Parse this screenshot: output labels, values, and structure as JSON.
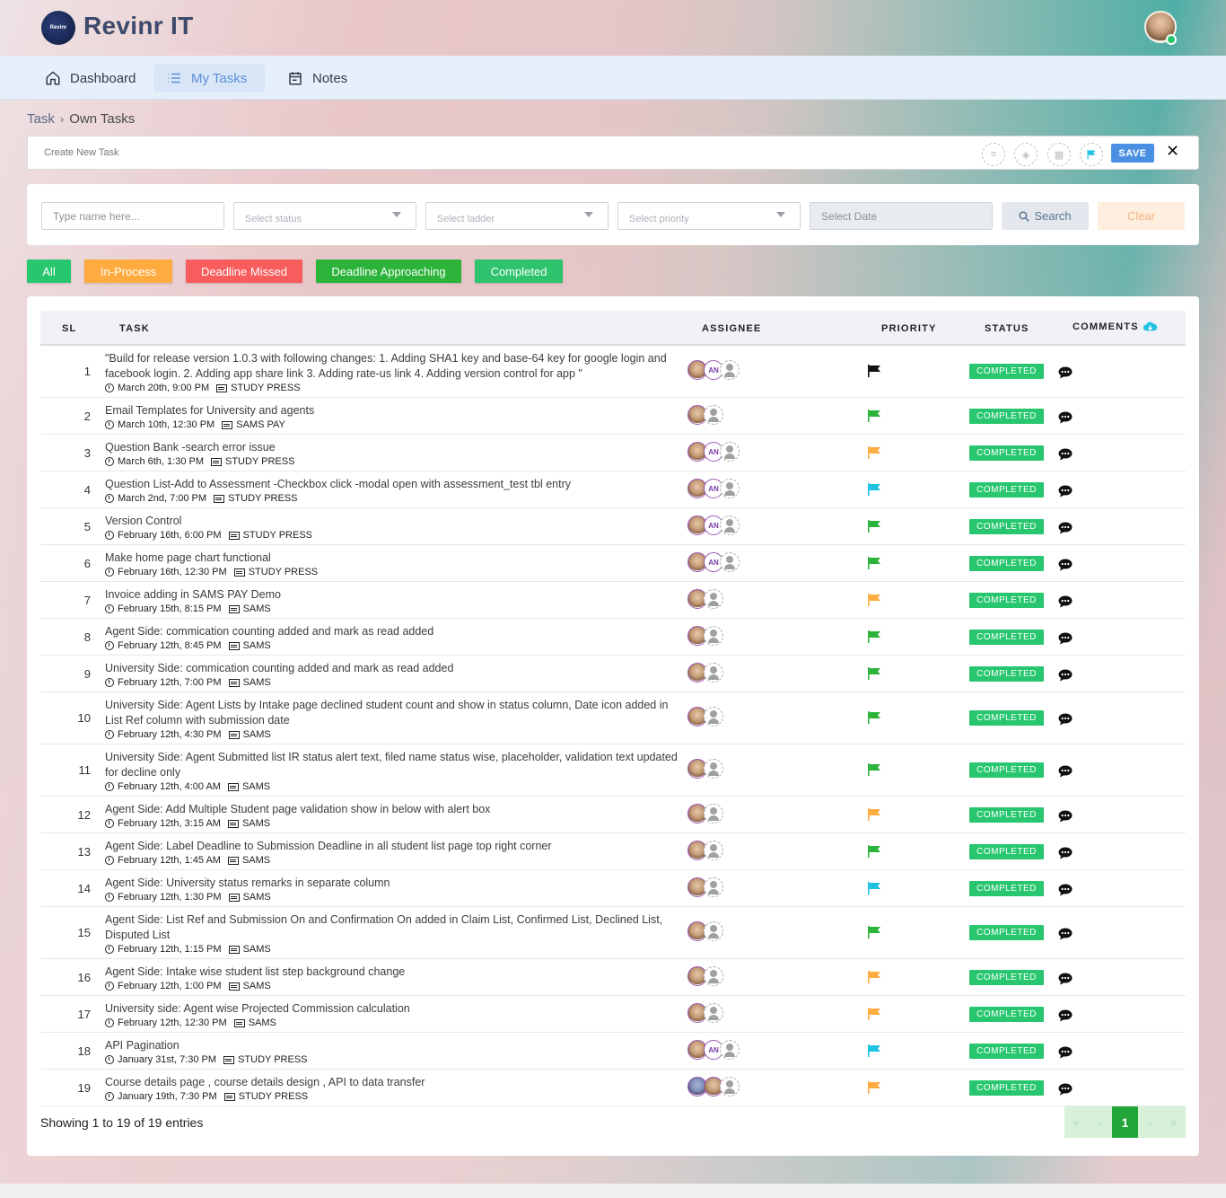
{
  "brand": {
    "name": "Revinr IT",
    "logo_text": "Revinr"
  },
  "nav": [
    {
      "label": "Dashboard",
      "icon": "home-icon"
    },
    {
      "label": "My Tasks",
      "icon": "list-icon",
      "active": true
    },
    {
      "label": "Notes",
      "icon": "calendar-icon"
    }
  ],
  "breadcrumb": {
    "parent": "Task",
    "current": "Own Tasks"
  },
  "create_task": {
    "placeholder": "Create New Task",
    "save_label": "SAVE"
  },
  "filters": {
    "name_placeholder": "Type name here...",
    "status_placeholder": "Select status",
    "ladder_placeholder": "Select ladder",
    "priority_placeholder": "Select priority",
    "date_placeholder": "Select Date",
    "search_label": "Search",
    "clear_label": "Clear"
  },
  "status_buttons": [
    {
      "label": "All",
      "color": "#28c76f"
    },
    {
      "label": "In-Process",
      "color": "#ffab40"
    },
    {
      "label": "Deadline Missed",
      "color": "#f85c5c"
    },
    {
      "label": "Deadline Approaching",
      "color": "#2bb33a"
    },
    {
      "label": "Completed",
      "color": "#2ec46d"
    }
  ],
  "table": {
    "headers": {
      "sl": "SL",
      "task": "TASK",
      "assignee": "ASSIGNEE",
      "priority": "PRIORITY",
      "status": "STATUS",
      "comments": "COMMENTS"
    },
    "rows": [
      {
        "sl": "1",
        "title": "\"Build for release version 1.0.3 with following changes: 1. Adding SHA1 key and base-64 key for google login and facebook login. 2. Adding app share link 3. Adding rate-us link 4. Adding version control for app \"",
        "date": "March 20th, 9:00 PM",
        "project": "STUDY PRESS",
        "an": true,
        "flag": "#111111",
        "status": "COMPLETED"
      },
      {
        "sl": "2",
        "title": "Email Templates for University and agents",
        "date": "March 10th, 12:30 PM",
        "project": "SAMS PAY",
        "an": false,
        "flag": "#2bb33a",
        "status": "COMPLETED"
      },
      {
        "sl": "3",
        "title": "Question Bank -search error issue",
        "date": "March 6th, 1:30 PM",
        "project": "STUDY PRESS",
        "an": true,
        "flag": "#ffab40",
        "status": "COMPLETED"
      },
      {
        "sl": "4",
        "title": "Question List-Add to Assessment -Checkbox click -modal open with assessment_test tbl entry",
        "date": "March 2nd, 7:00 PM",
        "project": "STUDY PRESS",
        "an": true,
        "flag": "#1ec2e0",
        "status": "COMPLETED"
      },
      {
        "sl": "5",
        "title": "Version Control",
        "date": "February 16th, 6:00 PM",
        "project": "STUDY PRESS",
        "an": true,
        "flag": "#2bb33a",
        "status": "COMPLETED"
      },
      {
        "sl": "6",
        "title": "Make home page chart functional",
        "date": "February 16th, 12:30 PM",
        "project": "STUDY PRESS",
        "an": true,
        "flag": "#2bb33a",
        "status": "COMPLETED"
      },
      {
        "sl": "7",
        "title": "Invoice adding in SAMS PAY Demo",
        "date": "February 15th, 8:15 PM",
        "project": "SAMS",
        "an": false,
        "flag": "#ffab40",
        "status": "COMPLETED"
      },
      {
        "sl": "8",
        "title": "Agent Side: commication counting added and mark as read added",
        "date": "February 12th, 8:45 PM",
        "project": "SAMS",
        "an": false,
        "flag": "#2bb33a",
        "status": "COMPLETED"
      },
      {
        "sl": "9",
        "title": "University Side: commication counting added and mark as read added",
        "date": "February 12th, 7:00 PM",
        "project": "SAMS",
        "an": false,
        "flag": "#2bb33a",
        "status": "COMPLETED"
      },
      {
        "sl": "10",
        "title": "University Side: Agent Lists by Intake page declined student count and show in status column, Date icon added in List Ref column with submission date",
        "date": "February 12th, 4:30 PM",
        "project": "SAMS",
        "an": false,
        "flag": "#2bb33a",
        "status": "COMPLETED"
      },
      {
        "sl": "11",
        "title": "University Side: Agent Submitted list IR status alert text, filed name status wise, placeholder, validation text updated for decline only",
        "date": "February 12th, 4:00 AM",
        "project": "SAMS",
        "an": false,
        "flag": "#2bb33a",
        "status": "COMPLETED"
      },
      {
        "sl": "12",
        "title": "Agent Side: Add Multiple Student page validation show in below with alert box",
        "date": "February 12th, 3:15 AM",
        "project": "SAMS",
        "an": false,
        "flag": "#ffab40",
        "status": "COMPLETED"
      },
      {
        "sl": "13",
        "title": "Agent Side: Label Deadline to Submission Deadline in all student list page top right corner",
        "date": "February 12th, 1:45 AM",
        "project": "SAMS",
        "an": false,
        "flag": "#2bb33a",
        "status": "COMPLETED"
      },
      {
        "sl": "14",
        "title": "Agent Side: University status remarks in separate column",
        "date": "February 12th, 1:30 PM",
        "project": "SAMS",
        "an": false,
        "flag": "#1ec2e0",
        "status": "COMPLETED"
      },
      {
        "sl": "15",
        "title": "Agent Side: List Ref and Submission On and Confirmation On added in Claim List, Confirmed List, Declined List, Disputed List",
        "date": "February 12th, 1:15 PM",
        "project": "SAMS",
        "an": false,
        "flag": "#2bb33a",
        "status": "COMPLETED"
      },
      {
        "sl": "16",
        "title": "Agent Side: Intake wise student list step background change",
        "date": "February 12th, 1:00 PM",
        "project": "SAMS",
        "an": false,
        "flag": "#ffab40",
        "status": "COMPLETED"
      },
      {
        "sl": "17",
        "title": "University side: Agent wise Projected Commission calculation",
        "date": "February 12th, 12:30 PM",
        "project": "SAMS",
        "an": false,
        "flag": "#ffab40",
        "status": "COMPLETED"
      },
      {
        "sl": "18",
        "title": "API Pagination",
        "date": "January 31st, 7:30 PM",
        "project": "STUDY PRESS",
        "an": true,
        "flag": "#1ec2e0",
        "status": "COMPLETED"
      },
      {
        "sl": "19",
        "title": "Course details page , course details design , API to data transfer",
        "date": "January 19th, 7:30 PM",
        "project": "STUDY PRESS",
        "an": false,
        "second_photo": true,
        "flag": "#ffab40",
        "status": "COMPLETED"
      }
    ]
  },
  "footer": {
    "showing": "Showing 1 to 19 of 19 entries",
    "current_page": "1"
  }
}
